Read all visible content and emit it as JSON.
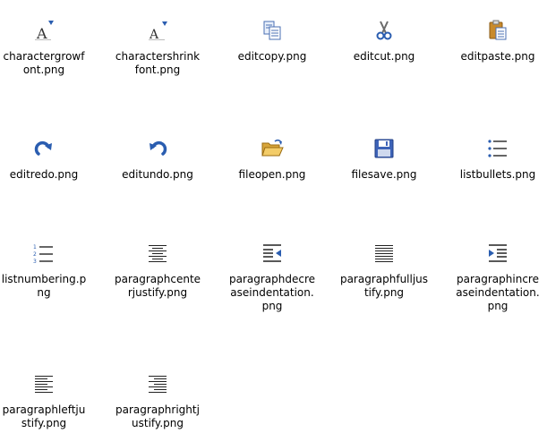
{
  "files": [
    {
      "name": "charactergrowfont.png",
      "label_lines": [
        "charactergrowf",
        "ont.png"
      ],
      "icon": "character-grow-font-icon"
    },
    {
      "name": "charactershrinkfont.png",
      "label_lines": [
        "charactershrink",
        "font.png"
      ],
      "icon": "character-shrink-font-icon"
    },
    {
      "name": "editcopy.png",
      "label_lines": [
        "editcopy.png"
      ],
      "icon": "copy-icon"
    },
    {
      "name": "editcut.png",
      "label_lines": [
        "editcut.png"
      ],
      "icon": "scissors-icon"
    },
    {
      "name": "editpaste.png",
      "label_lines": [
        "editpaste.png"
      ],
      "icon": "paste-icon"
    },
    {
      "name": "editredo.png",
      "label_lines": [
        "editredo.png"
      ],
      "icon": "redo-icon"
    },
    {
      "name": "editundo.png",
      "label_lines": [
        "editundo.png"
      ],
      "icon": "undo-icon"
    },
    {
      "name": "fileopen.png",
      "label_lines": [
        "fileopen.png"
      ],
      "icon": "folder-open-icon"
    },
    {
      "name": "filesave.png",
      "label_lines": [
        "filesave.png"
      ],
      "icon": "floppy-disk-icon"
    },
    {
      "name": "listbullets.png",
      "label_lines": [
        "listbullets.png"
      ],
      "icon": "bulleted-list-icon"
    },
    {
      "name": "listnumbering.png",
      "label_lines": [
        "listnumbering.p",
        "ng"
      ],
      "icon": "numbered-list-icon"
    },
    {
      "name": "paragraphcenterjustify.png",
      "label_lines": [
        "paragraphcente",
        "rjustify.png"
      ],
      "icon": "align-center-icon"
    },
    {
      "name": "paragraphdecreaseindentation.png",
      "label_lines": [
        "paragraphdecre",
        "aseindentation.",
        "png"
      ],
      "icon": "decrease-indent-icon"
    },
    {
      "name": "paragraphfulljustify.png",
      "label_lines": [
        "paragraphfulljus",
        "tify.png"
      ],
      "icon": "align-justify-icon"
    },
    {
      "name": "paragraphincreaseindentation.png",
      "label_lines": [
        "paragraphincre",
        "aseindentation.",
        "png"
      ],
      "icon": "increase-indent-icon"
    },
    {
      "name": "paragraphleftjustify.png",
      "label_lines": [
        "paragraphleftju",
        "stify.png"
      ],
      "icon": "align-left-icon"
    },
    {
      "name": "paragraphrightjustify.png",
      "label_lines": [
        "paragraphrightj",
        "ustify.png"
      ],
      "icon": "align-right-icon"
    }
  ]
}
